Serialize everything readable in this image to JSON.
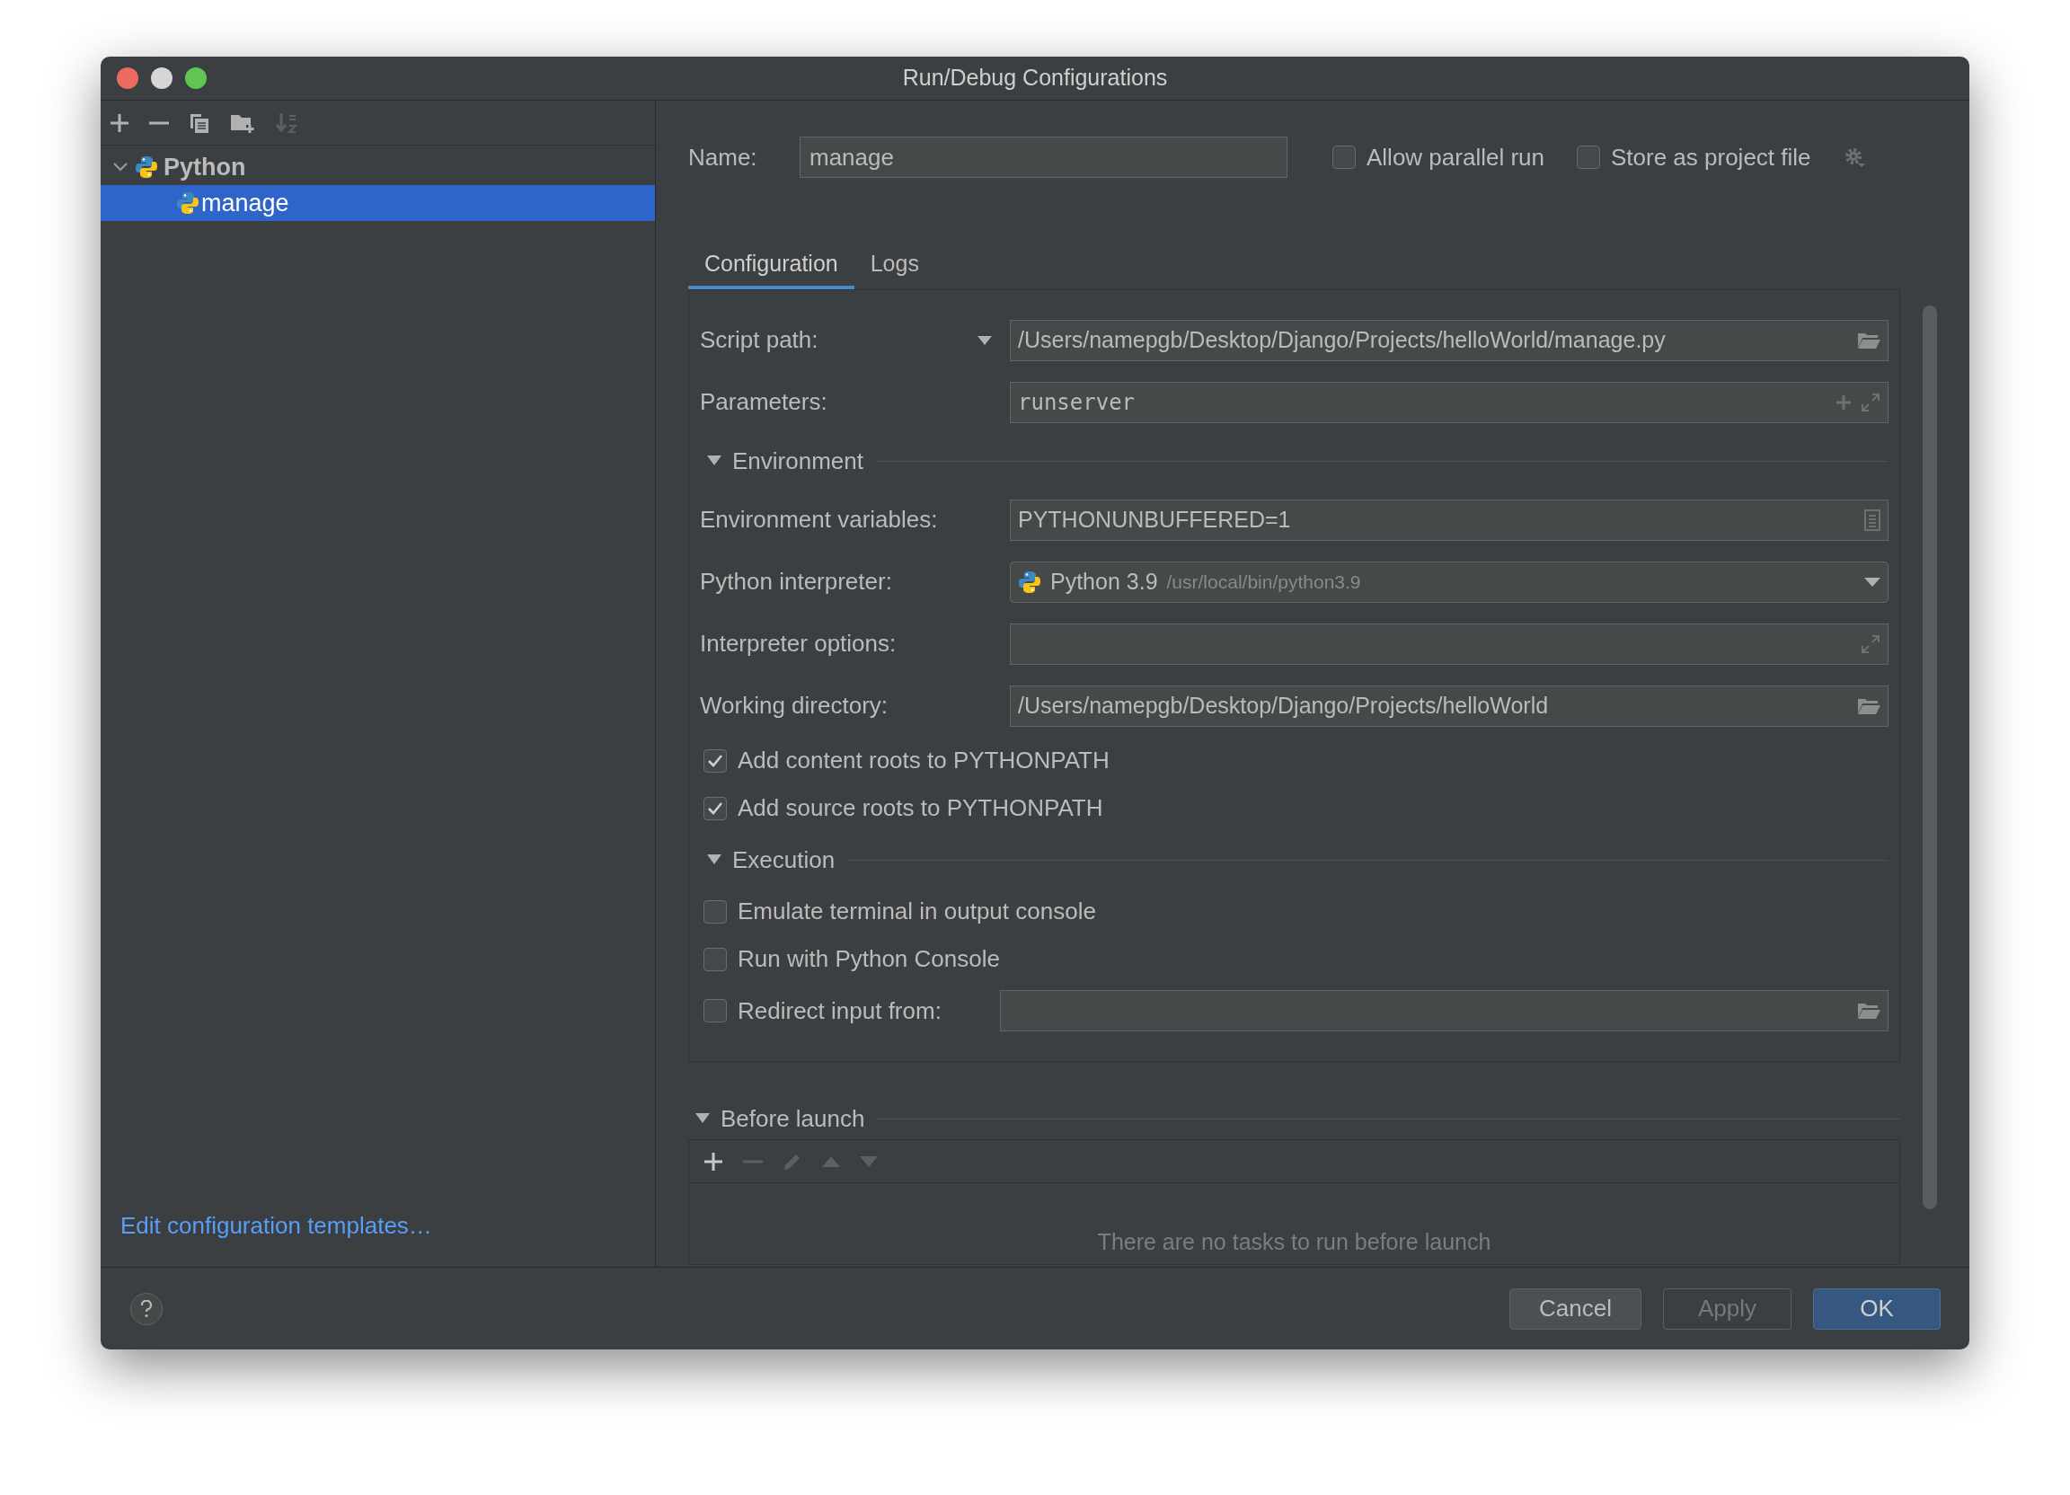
{
  "window": {
    "title": "Run/Debug Configurations"
  },
  "sidebar": {
    "toolbar": [
      {
        "kind": "add",
        "disabled": false
      },
      {
        "kind": "remove",
        "disabled": false
      },
      {
        "kind": "copy",
        "disabled": false
      },
      {
        "kind": "folder",
        "disabled": false
      },
      {
        "kind": "sort",
        "disabled": true
      }
    ],
    "tree": [
      {
        "label": "Python",
        "expanded": true,
        "selected": false,
        "children": [
          {
            "label": "manage",
            "selected": true
          }
        ]
      }
    ],
    "link": "Edit configuration templates…"
  },
  "name": {
    "label": "Name:",
    "value": "manage"
  },
  "options": [
    {
      "label": "Allow parallel run",
      "checked": false
    },
    {
      "label": "Store as project file",
      "checked": false
    }
  ],
  "tabs": [
    {
      "label": "Configuration",
      "selected": true
    },
    {
      "label": "Logs",
      "selected": false
    }
  ],
  "rows": [
    {
      "kind": "path",
      "label": "Script path:",
      "value": "/Users/namepgb/Desktop/Django/Projects/helloWorld/manage.py",
      "dropdown": true
    },
    {
      "kind": "params",
      "label": "Parameters:",
      "value": "runserver"
    },
    {
      "kind": "section",
      "label": "Environment",
      "expanded": true
    },
    {
      "kind": "env",
      "label": "Environment variables:",
      "value": "PYTHONUNBUFFERED=1"
    },
    {
      "kind": "interpreter",
      "label": "Python interpreter:",
      "value": "Python 3.9",
      "detail": "/usr/local/bin/python3.9"
    },
    {
      "kind": "expand",
      "label": "Interpreter options:"
    },
    {
      "kind": "path",
      "label": "Working directory:",
      "value": "/Users/namepgb/Desktop/Django/Projects/helloWorld",
      "dropdown": false
    },
    {
      "kind": "checkbox",
      "label": "Add content roots to PYTHONPATH",
      "checked": true
    },
    {
      "kind": "checkbox",
      "label": "Add source roots to PYTHONPATH",
      "checked": true
    },
    {
      "kind": "section",
      "label": "Execution",
      "expanded": true
    },
    {
      "kind": "checkbox",
      "label": "Emulate terminal in output console",
      "checked": false
    },
    {
      "kind": "checkbox",
      "label": "Run with Python Console",
      "checked": false
    },
    {
      "kind": "checkbox_field",
      "label": "Redirect input from:",
      "checked": false
    }
  ],
  "before_launch": {
    "title": "Before launch",
    "expanded": true,
    "toolbar": [
      {
        "kind": "add",
        "disabled": false
      },
      {
        "kind": "remove",
        "disabled": true
      },
      {
        "kind": "edit",
        "disabled": true
      },
      {
        "kind": "up",
        "disabled": true
      },
      {
        "kind": "down",
        "disabled": true
      }
    ],
    "empty_text": "There are no tasks to run before launch"
  },
  "buttons": [
    {
      "label": "Cancel",
      "kind": "normal",
      "disabled": false
    },
    {
      "label": "Apply",
      "kind": "normal",
      "disabled": true
    },
    {
      "label": "OK",
      "kind": "default",
      "disabled": false
    }
  ]
}
